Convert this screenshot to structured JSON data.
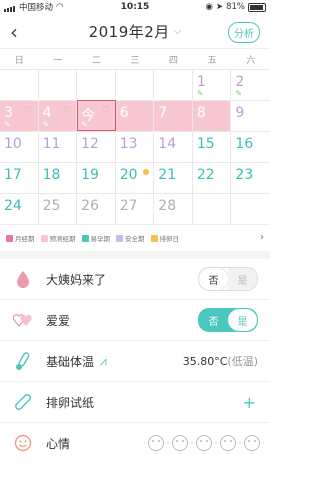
{
  "status": {
    "carrier": "中国移动",
    "time": "10:15",
    "battery": "81%"
  },
  "nav": {
    "title": "2019年2月",
    "analysis": "分析"
  },
  "weekdays": [
    "日",
    "一",
    "二",
    "三",
    "四",
    "五",
    "六"
  ],
  "calendar": {
    "rows": [
      [
        {
          "n": "",
          "c": "blank"
        },
        {
          "n": "",
          "c": "blank"
        },
        {
          "n": "",
          "c": "blank"
        },
        {
          "n": "",
          "c": "blank"
        },
        {
          "n": "",
          "c": "blank"
        },
        {
          "n": "1",
          "c": "purple",
          "pencil": true
        },
        {
          "n": "2",
          "c": "purple",
          "pencil": true
        }
      ],
      [
        {
          "n": "3",
          "c": "pink",
          "heart": true,
          "pencil": true
        },
        {
          "n": "4",
          "c": "pink",
          "heart": true,
          "pencil": true
        },
        {
          "n": "今",
          "c": "pink today",
          "heart": true,
          "pencil": true
        },
        {
          "n": "6",
          "c": "pink"
        },
        {
          "n": "7",
          "c": "pink"
        },
        {
          "n": "8",
          "c": "pink"
        },
        {
          "n": "9",
          "c": "purple"
        }
      ],
      [
        {
          "n": "10",
          "c": "purple"
        },
        {
          "n": "11",
          "c": "purple"
        },
        {
          "n": "12",
          "c": "purple"
        },
        {
          "n": "13",
          "c": "purple"
        },
        {
          "n": "14",
          "c": "purple"
        },
        {
          "n": "15",
          "c": "teal"
        },
        {
          "n": "16",
          "c": "teal"
        }
      ],
      [
        {
          "n": "17",
          "c": "teal"
        },
        {
          "n": "18",
          "c": "teal"
        },
        {
          "n": "19",
          "c": "teal"
        },
        {
          "n": "20",
          "c": "teal",
          "sun": true
        },
        {
          "n": "21",
          "c": "teal"
        },
        {
          "n": "22",
          "c": "teal"
        },
        {
          "n": "23",
          "c": "teal"
        }
      ],
      [
        {
          "n": "24",
          "c": "teal"
        },
        {
          "n": "25",
          "c": "muted"
        },
        {
          "n": "26",
          "c": "muted"
        },
        {
          "n": "27",
          "c": "muted"
        },
        {
          "n": "28",
          "c": "muted"
        },
        {
          "n": "",
          "c": "blank"
        },
        {
          "n": "",
          "c": "blank"
        }
      ]
    ]
  },
  "legend": [
    {
      "label": "月经期",
      "color": "#e77b94"
    },
    {
      "label": "预测经期",
      "color": "#f7c8d1"
    },
    {
      "label": "易孕期",
      "color": "#4cc7bd"
    },
    {
      "label": "安全期",
      "color": "#c9b9e6"
    },
    {
      "label": "排卵日",
      "color": "#f2c14e"
    }
  ],
  "rows": {
    "period": {
      "label": "大姨妈来了",
      "no": "否",
      "yes": "是"
    },
    "love": {
      "label": "爱爱",
      "no": "否",
      "yes": "是"
    },
    "temp": {
      "label": "基础体温",
      "value": "35.80°C",
      "unit": "(低温)"
    },
    "ovulation": {
      "label": "排卵试纸"
    },
    "mood": {
      "label": "心情"
    }
  }
}
